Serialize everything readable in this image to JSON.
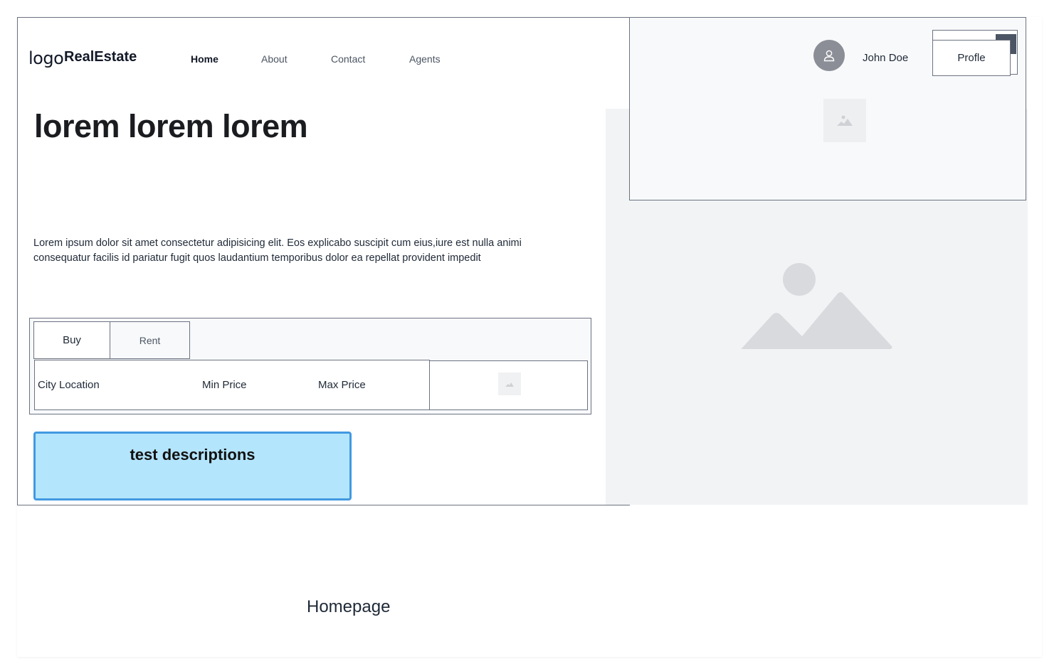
{
  "header": {
    "logo_text": "logo",
    "brand": "RealEstate",
    "nav": [
      {
        "label": "Home",
        "active": true
      },
      {
        "label": "About",
        "active": false
      },
      {
        "label": "Contact",
        "active": false
      },
      {
        "label": "Agents",
        "active": false
      }
    ]
  },
  "user": {
    "name": "John Doe",
    "avatar_icon": "user-icon",
    "profile_button": "Profle"
  },
  "hero": {
    "headline": "lorem lorem lorem",
    "paragraph": "Lorem ipsum dolor sit amet consectetur adipisicing elit. Eos explicabo suscipit cum eius,iure est nulla animi consequatur facilis id pariatur fugit quos laudantium temporibus dolor ea repellat provident impedit"
  },
  "search": {
    "tabs": [
      "Buy",
      "Rent"
    ],
    "fields": [
      "City Location",
      "Min Price",
      "Max Price"
    ],
    "button_icon": "image-placeholder-icon"
  },
  "note": {
    "title": "test descriptions"
  },
  "footer": {
    "page_label": "Homepage"
  },
  "colors": {
    "accent_border": "#4299e1",
    "note_fill": "#b3e5fc",
    "image_placeholder": "#d9dadd"
  }
}
